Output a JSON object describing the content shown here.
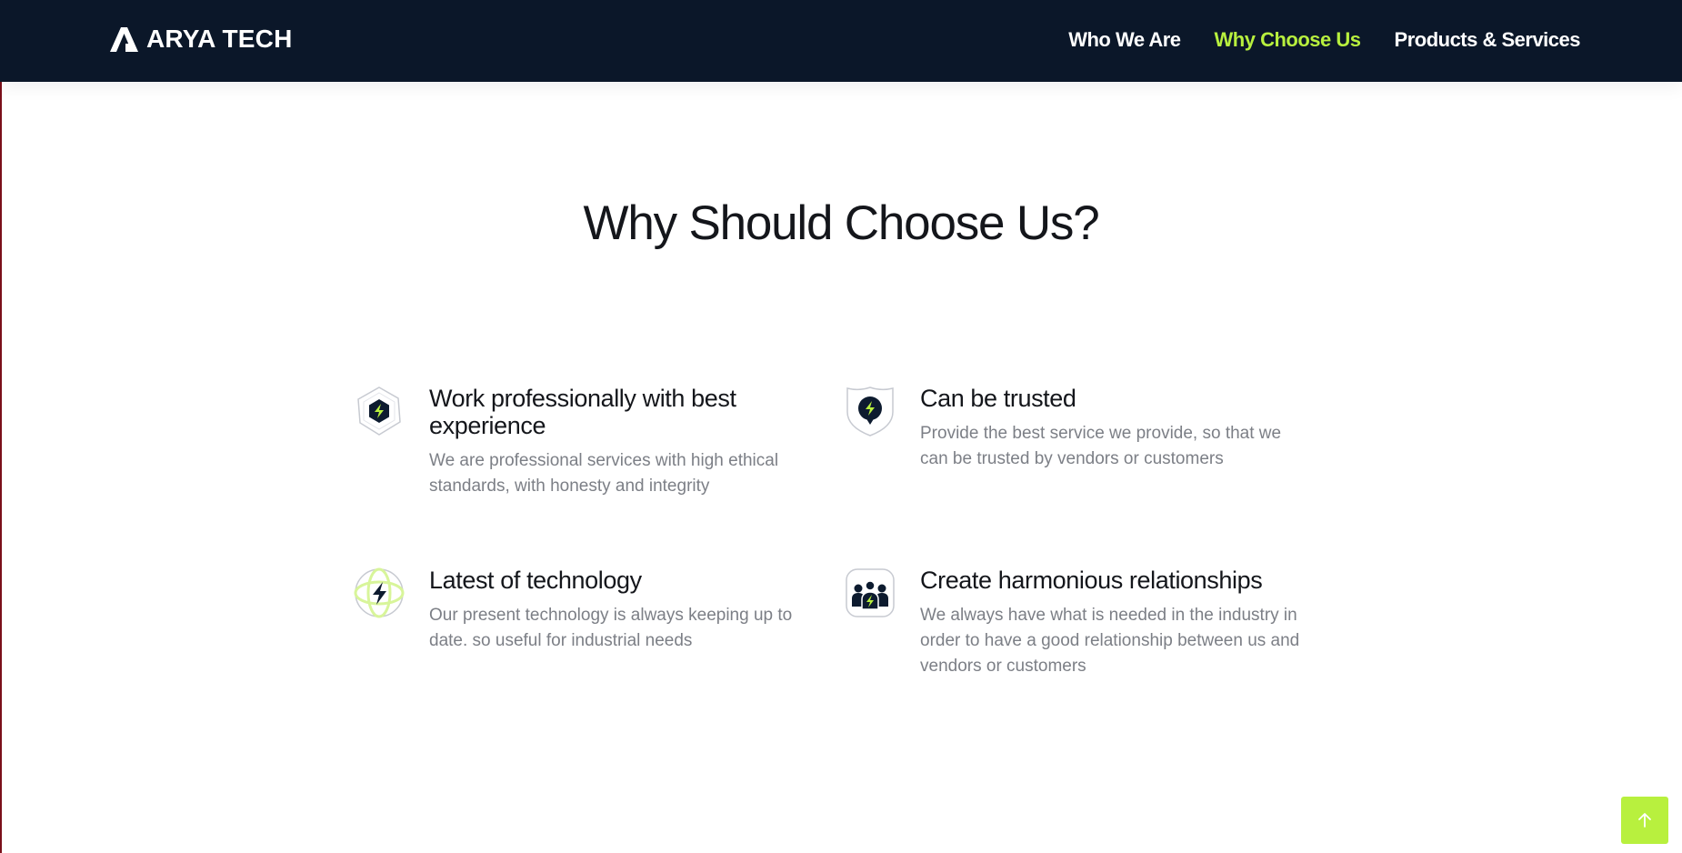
{
  "brand": {
    "name": "ARYA TECH"
  },
  "nav": {
    "items": [
      {
        "label": "Who We Are",
        "active": false
      },
      {
        "label": "Why Choose Us",
        "active": true
      },
      {
        "label": "Products & Services",
        "active": false
      }
    ]
  },
  "section": {
    "title": "Why Should Choose Us?",
    "features": [
      {
        "icon": "hexagon-bolt-icon",
        "title": "Work professionally with best experience",
        "description": "We are professional services with high ethical standards, with honesty and integrity"
      },
      {
        "icon": "shield-bolt-icon",
        "title": "Can be trusted",
        "description": "Provide the best service we provide, so that we can be trusted by vendors or customers"
      },
      {
        "icon": "globe-bolt-icon",
        "title": "Latest of technology",
        "description": "Our present technology is always keeping up to date. so useful for industrial needs"
      },
      {
        "icon": "team-bolt-icon",
        "title": "Create harmonious relationships",
        "description": "We always have what is needed in the industry in order to have a good relationship between us and vendors or customers"
      }
    ]
  },
  "scroll_top": {
    "icon": "arrow-up-icon"
  },
  "colors": {
    "navbar_bg": "#0b1729",
    "accent": "#b8f03e",
    "heading": "#14161b",
    "body_text": "#7c7f86"
  }
}
